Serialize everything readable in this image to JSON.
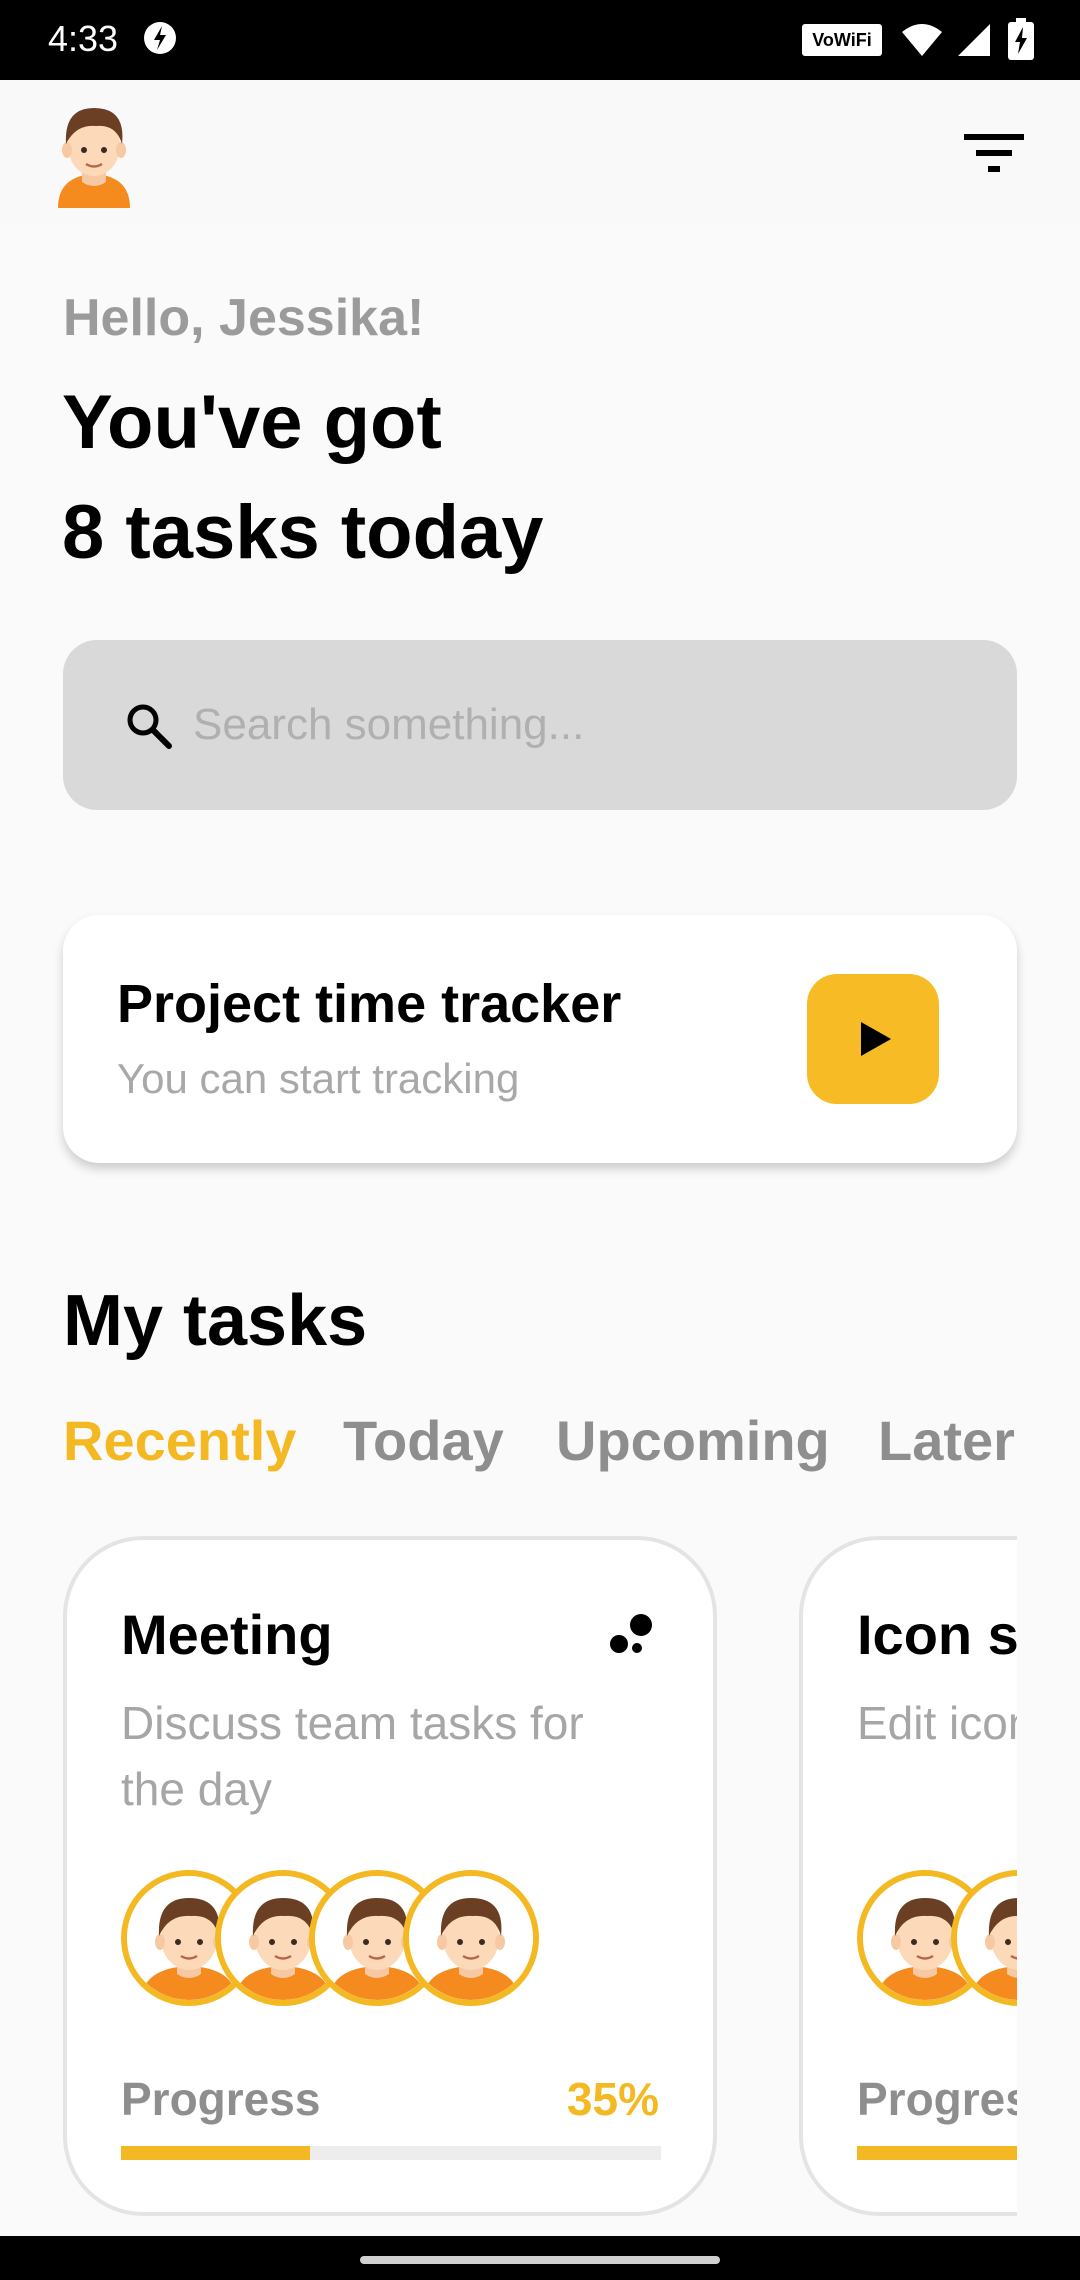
{
  "status_bar": {
    "time": "4:33",
    "vowifi_label": "VoWiFi"
  },
  "header": {
    "avatar_icon": "user-avatar-icon",
    "filter_icon": "filter-icon"
  },
  "greeting": {
    "hello": "Hello, Jessika!",
    "line1": "You've got",
    "line2": "8 tasks today"
  },
  "search": {
    "placeholder": "Search something..."
  },
  "tracker": {
    "title": "Project time tracker",
    "subtitle": "You can start tracking",
    "play_icon": "play-icon"
  },
  "tasks": {
    "section_title": "My tasks",
    "tabs": [
      {
        "label": "Recently",
        "active": true
      },
      {
        "label": "Today",
        "active": false
      },
      {
        "label": "Upcoming",
        "active": false
      },
      {
        "label": "Later",
        "active": false
      }
    ],
    "cards": [
      {
        "title": "Meeting",
        "description": "Discuss team tasks for the day",
        "avatar_count": 4,
        "progress_label": "Progress",
        "progress_value": "35%",
        "progress_fraction": 0.35
      },
      {
        "title": "Icon set",
        "description": "Edit icons",
        "avatar_count": 2,
        "progress_label": "Progress",
        "progress_value": "",
        "progress_fraction": 1.0
      }
    ]
  },
  "colors": {
    "accent": "#f4b922",
    "background": "#fafafa",
    "search_bg": "#d9d9d9"
  }
}
